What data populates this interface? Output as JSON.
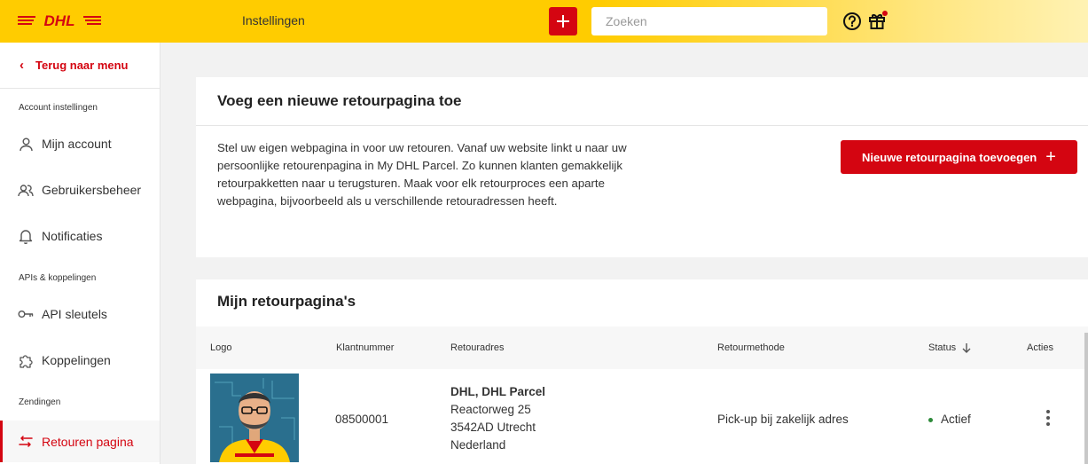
{
  "header": {
    "title": "Instellingen",
    "search_placeholder": "Zoeken",
    "logo_text": "DHL",
    "icons": [
      "plus-icon",
      "help-icon",
      "gift-icon"
    ],
    "accent_color": "#d40511",
    "brand_color": "#ffcc00"
  },
  "sidebar": {
    "back_label": "Terug naar menu",
    "sections": [
      {
        "title": "Account instellingen",
        "items": [
          {
            "label": "Mijn account",
            "icon": "user-icon"
          },
          {
            "label": "Gebruikersbeheer",
            "icon": "users-icon"
          },
          {
            "label": "Notificaties",
            "icon": "bell-icon"
          }
        ]
      },
      {
        "title": "APIs & koppelingen",
        "items": [
          {
            "label": "API sleutels",
            "icon": "key-icon"
          },
          {
            "label": "Koppelingen",
            "icon": "puzzle-icon"
          }
        ]
      },
      {
        "title": "Zendingen",
        "items": [
          {
            "label": "Retouren pagina",
            "icon": "return-icon",
            "active": true
          }
        ]
      }
    ]
  },
  "add_card": {
    "title": "Voeg een nieuwe retourpagina toe",
    "description": "Stel uw eigen webpagina in voor uw retouren. Vanaf uw website linkt u naar uw persoonlijke retourenpagina in My DHL Parcel. Zo kunnen klanten gemakkelijk retourpakketten naar u terugsturen. Maak voor elk retourproces een aparte webpagina, bijvoorbeeld als u verschillende retouradressen heeft.",
    "button_label": "Nieuwe retourpagina toevoegen",
    "button_icon": "+"
  },
  "list_card": {
    "title": "Mijn retourpagina's",
    "columns": [
      "Logo",
      "Klantnummer",
      "Retouradres",
      "Retourmethode",
      "Status",
      "Acties"
    ],
    "rows": [
      {
        "customer_number": "08500001",
        "address": [
          "DHL, DHL Parcel",
          "Reactorweg 25",
          "3542AD Utrecht",
          "Nederland"
        ],
        "method": "Pick-up bij zakelijk adres",
        "status": "Actief",
        "status_color": "#2d8a3a"
      }
    ]
  }
}
